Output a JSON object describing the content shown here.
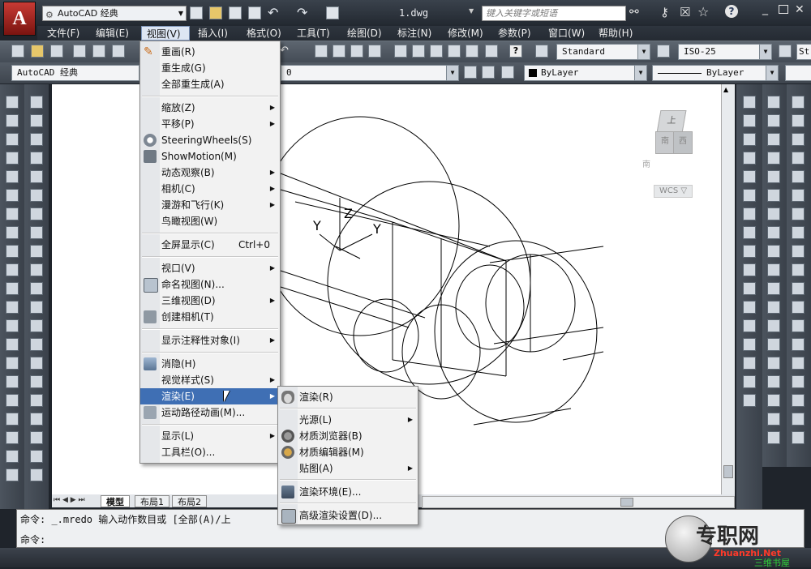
{
  "app": {
    "logo_letter": "A",
    "workspace": "AutoCAD 经典",
    "document_title": "1.dwg",
    "search_placeholder": "键入关键字或短语"
  },
  "menubar": [
    "文件(F)",
    "编辑(E)",
    "视图(V)",
    "插入(I)",
    "格式(O)",
    "工具(T)",
    "绘图(D)",
    "标注(N)",
    "修改(M)",
    "参数(P)",
    "窗口(W)",
    "帮助(H)"
  ],
  "toolbar": {
    "text_style": "Standard",
    "dim_style": "ISO-25",
    "table_style": "St",
    "workspace2": "AutoCAD 经典",
    "layer": "0",
    "color": "ByLayer",
    "linetype": "ByLayer"
  },
  "view_menu": {
    "items": [
      {
        "label": "重画(R)"
      },
      {
        "label": "重生成(G)"
      },
      {
        "label": "全部重生成(A)"
      },
      {
        "label": "缩放(Z)",
        "submenu": true
      },
      {
        "label": "平移(P)",
        "submenu": true
      },
      {
        "label": "SteeringWheels(S)"
      },
      {
        "label": "ShowMotion(M)"
      },
      {
        "label": "动态观察(B)",
        "submenu": true
      },
      {
        "label": "相机(C)",
        "submenu": true
      },
      {
        "label": "漫游和飞行(K)",
        "submenu": true
      },
      {
        "label": "鸟瞰视图(W)"
      },
      {
        "label": "全屏显示(C)",
        "shortcut": "Ctrl+0"
      },
      {
        "label": "视口(V)",
        "submenu": true
      },
      {
        "label": "命名视图(N)..."
      },
      {
        "label": "三维视图(D)",
        "submenu": true
      },
      {
        "label": "创建相机(T)"
      },
      {
        "label": "显示注释性对象(I)",
        "submenu": true
      },
      {
        "label": "消隐(H)"
      },
      {
        "label": "视觉样式(S)",
        "submenu": true
      },
      {
        "label": "渲染(E)",
        "submenu": true,
        "highlighted": true
      },
      {
        "label": "运动路径动画(M)..."
      },
      {
        "label": "显示(L)",
        "submenu": true
      },
      {
        "label": "工具栏(O)..."
      }
    ]
  },
  "render_submenu": {
    "items": [
      {
        "label": "渲染(R)"
      },
      {
        "label": "光源(L)",
        "submenu": true
      },
      {
        "label": "材质浏览器(B)"
      },
      {
        "label": "材质编辑器(M)"
      },
      {
        "label": "贴图(A)",
        "submenu": true
      },
      {
        "label": "渲染环境(E)..."
      },
      {
        "label": "高级渲染设置(D)..."
      }
    ]
  },
  "viewcube": {
    "top": "上",
    "front": "南",
    "right": "西",
    "compass": "南",
    "wcs": "WCS"
  },
  "ucs": {
    "z": "Z",
    "y": "Y"
  },
  "layout_tabs": [
    "模型",
    "布局1",
    "布局2"
  ],
  "command": {
    "line1": "命令: _.mredo 输入动作数目或 [全部(A)/上",
    "line2": "命令:"
  },
  "watermark": {
    "title": "专职网",
    "sub": "Zhuanzhi.Net",
    "sub2": "三维书屋"
  },
  "colors": {
    "highlight": "#3f6fb4",
    "menu_bg": "#f2f2f2",
    "frame": "#2b3139"
  }
}
